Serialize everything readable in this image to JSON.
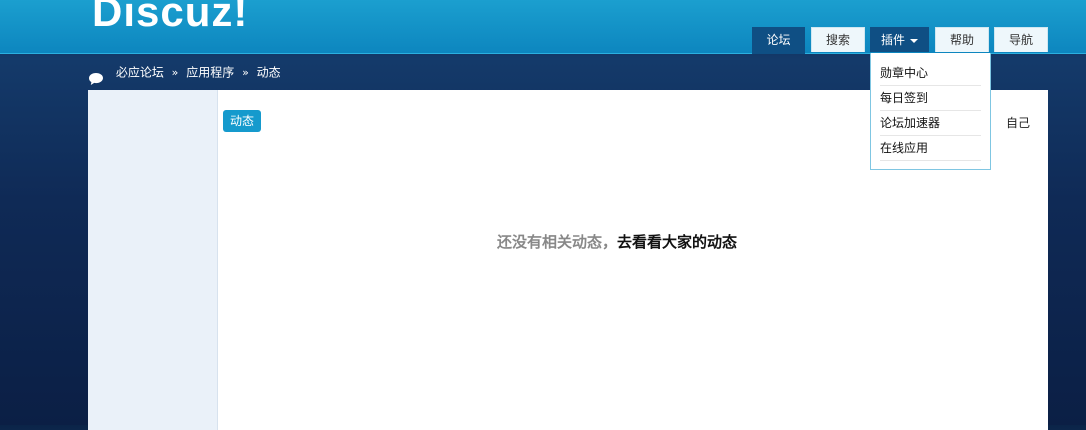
{
  "logo": "Discuz!",
  "nav": [
    {
      "label": "论坛"
    },
    {
      "label": "搜索"
    },
    {
      "label": "插件"
    },
    {
      "label": "帮助"
    },
    {
      "label": "导航"
    }
  ],
  "breadcrumb": {
    "items": [
      "必应论坛",
      "应用程序",
      "动态"
    ],
    "separator": "»"
  },
  "tabs": {
    "active": "动态",
    "right": "自己"
  },
  "empty_state": {
    "muted_text": "还没有相关动态，",
    "link_text": "去看看大家的动态"
  },
  "plugin_menu": {
    "items": [
      "勋章中心",
      "每日签到",
      "论坛加速器",
      "在线应用"
    ]
  },
  "colors": {
    "header": "#1499cc",
    "active_nav": "#0f4f84",
    "tab": "#159acd",
    "sidebar": "#eaf1f9"
  }
}
